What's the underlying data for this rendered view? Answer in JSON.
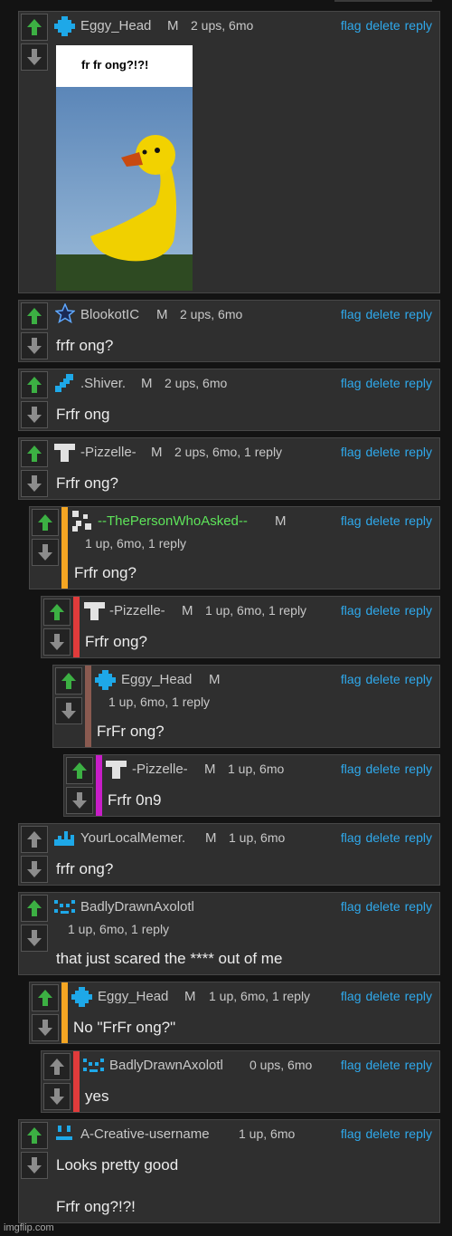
{
  "actions": {
    "flag": "flag",
    "delete": "delete",
    "reply": "reply"
  },
  "comments": [
    {
      "user": "Eggy_Head",
      "mod": "M",
      "meta": "2 ups, 6mo",
      "text": "",
      "image_caption": "fr fr ong?!?!"
    },
    {
      "user": "BlookotIC",
      "mod": "M",
      "meta": "2 ups, 6mo",
      "text": "frfr ong?"
    },
    {
      "user": ".Shiver.",
      "mod": "M",
      "meta": "2 ups, 6mo",
      "text": "Frfr ong"
    },
    {
      "user": "-Pizzelle-",
      "mod": "M",
      "meta": "2 ups, 6mo, 1 reply",
      "text": "Frfr ong?"
    },
    {
      "user": "--ThePersonWhoAsked--",
      "mod": "M",
      "meta": "1 up, 6mo, 1 reply",
      "text": "Frfr ong?"
    },
    {
      "user": "-Pizzelle-",
      "mod": "M",
      "meta": "1 up, 6mo, 1 reply",
      "text": "Frfr ong?"
    },
    {
      "user": "Eggy_Head",
      "mod": "M",
      "meta": "1 up, 6mo, 1 reply",
      "text": "FrFr ong?"
    },
    {
      "user": "-Pizzelle-",
      "mod": "M",
      "meta": "1 up, 6mo",
      "text": "Frfr 0n9"
    },
    {
      "user": "YourLocalMemer.",
      "mod": "M",
      "meta": "1 up, 6mo",
      "text": "frfr ong?"
    },
    {
      "user": "BadlyDrawnAxolotl",
      "mod": "",
      "meta": "1 up, 6mo, 1 reply",
      "text": "that just scared the **** out of me"
    },
    {
      "user": "Eggy_Head",
      "mod": "M",
      "meta": "1 up, 6mo, 1 reply",
      "text": "No \"FrFr ong?\""
    },
    {
      "user": "BadlyDrawnAxolotl",
      "mod": "",
      "meta": "0 ups, 6mo",
      "text": "yes"
    },
    {
      "user": "A-Creative-username",
      "mod": "",
      "meta": "1 up, 6mo",
      "text": "Looks pretty good",
      "text2": "Frfr ong?!?!"
    }
  ],
  "colors": {
    "upvote_active": "#3cb043",
    "link": "#2fa9ec",
    "reply_bar_orange": "#f5a623",
    "reply_bar_red": "#e03b3b",
    "reply_bar_brown": "#8a5a50",
    "reply_bar_magenta": "#c81ec8"
  },
  "watermark": "imgflip.com"
}
